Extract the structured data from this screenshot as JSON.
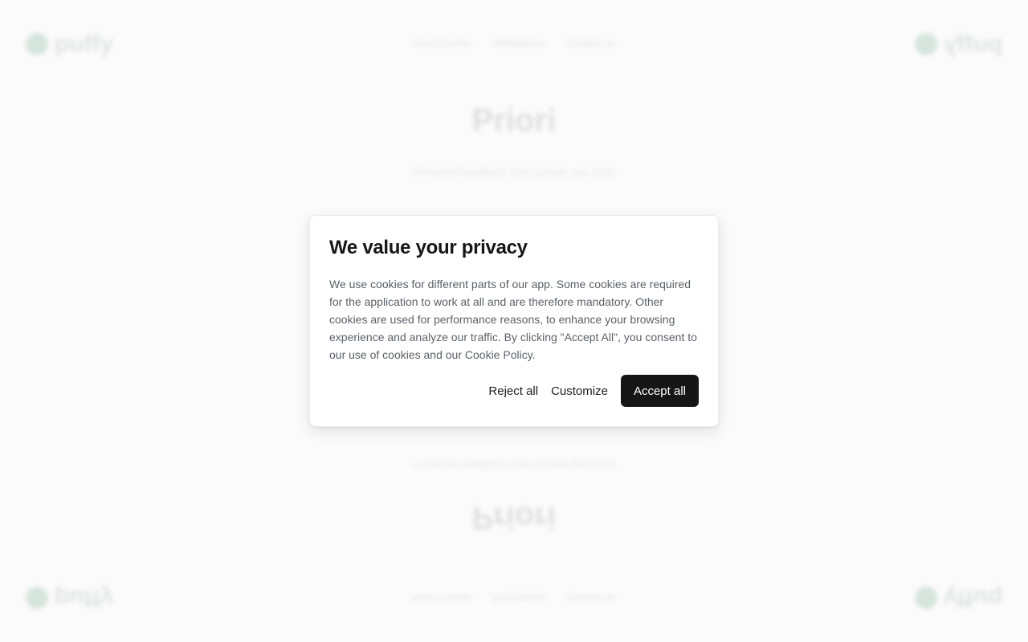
{
  "background": {
    "logo_text": "puffy",
    "nav": [
      "How it works",
      "Attributions",
      "Contact us"
    ],
    "title": "Priori",
    "subtitle": "Personal feedback from people you trust"
  },
  "cookie_modal": {
    "title": "We value your privacy",
    "body": "We use cookies for different parts of our app. Some cookies are required for the application to work at all and are therefore mandatory. Other cookies are used for performance reasons, to enhance your browsing experience and analyze our traffic. By clicking \"Accept All\", you consent to our use of cookies and our Cookie Policy.",
    "reject_label": "Reject all",
    "customize_label": "Customize",
    "accept_label": "Accept all"
  },
  "colors": {
    "accent": "#161616",
    "body_text": "#5b6168",
    "background": "#fbfbfb"
  }
}
